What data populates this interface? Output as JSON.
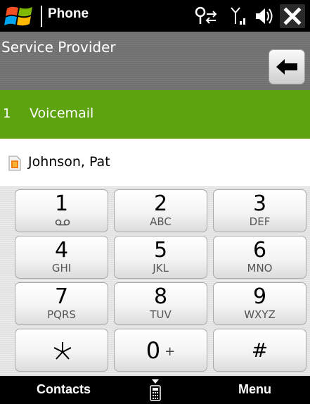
{
  "titlebar": {
    "app_title": "Phone",
    "icons": [
      "windows-start-icon",
      "connectivity-icon",
      "signal-icon",
      "volume-icon",
      "close-icon"
    ]
  },
  "header": {
    "title": "Service Provider",
    "back_icon": "backspace-arrow-icon"
  },
  "speed_dial": {
    "number": "1",
    "label": "Voicemail",
    "highlight_color": "#5da20f"
  },
  "contact": {
    "name": "Johnson, Pat",
    "icon": "contact-card-icon"
  },
  "keypad": {
    "keys": [
      {
        "digit": "1",
        "letters": "",
        "voicemail_icon": true
      },
      {
        "digit": "2",
        "letters": "ABC"
      },
      {
        "digit": "3",
        "letters": "DEF"
      },
      {
        "digit": "4",
        "letters": "GHI"
      },
      {
        "digit": "5",
        "letters": "JKL"
      },
      {
        "digit": "6",
        "letters": "MNO"
      },
      {
        "digit": "7",
        "letters": "PQRS"
      },
      {
        "digit": "8",
        "letters": "TUV"
      },
      {
        "digit": "9",
        "letters": "WXYZ"
      },
      {
        "symbol": "*"
      },
      {
        "digit": "0",
        "plus": "+"
      },
      {
        "symbol": "#"
      }
    ]
  },
  "softkeys": {
    "left": "Contacts",
    "right": "Menu",
    "center_icon": "keyboard-toggle-icon"
  }
}
